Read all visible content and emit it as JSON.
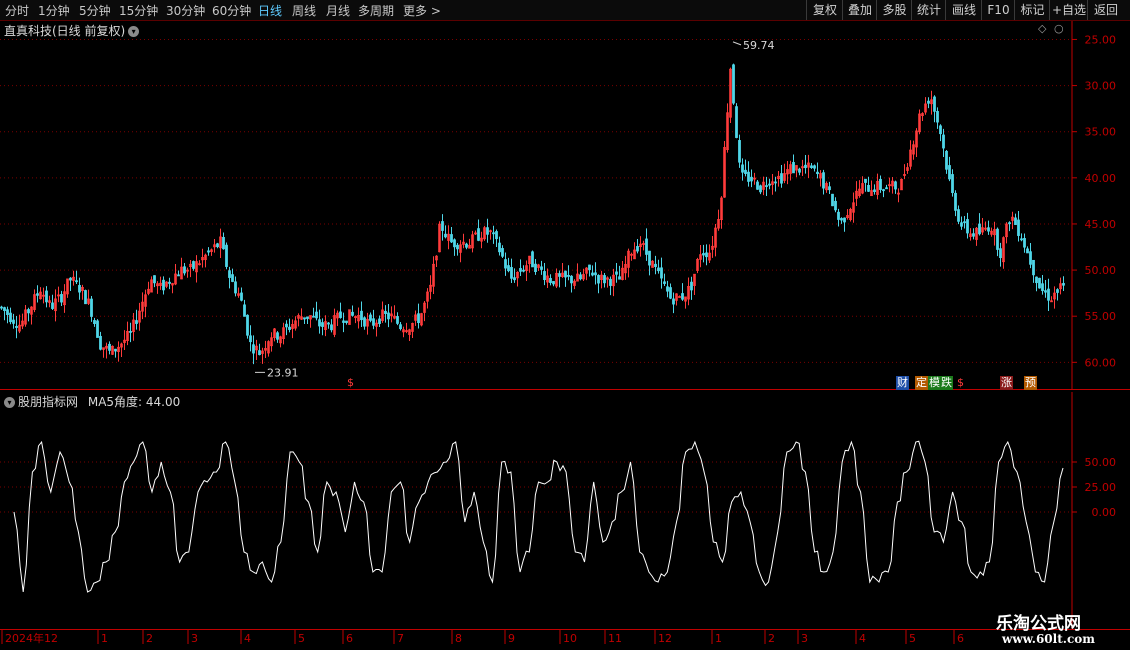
{
  "toolbar": {
    "periods": [
      "分时",
      "1分钟",
      "5分钟",
      "15分钟",
      "30分钟",
      "60分钟",
      "日线",
      "周线",
      "月线",
      "多周期",
      "更多 >"
    ],
    "active_period": "日线",
    "buttons": [
      "复权",
      "叠加",
      "多股",
      "统计",
      "画线",
      "F10",
      "标记",
      "+自选",
      "返回"
    ]
  },
  "main": {
    "title": "直真科技(日线 前复权)",
    "y_ticks": [
      "60.00",
      "55.00",
      "50.00",
      "45.00",
      "40.00",
      "35.00",
      "30.00",
      "25.00"
    ],
    "high_label": "59.74",
    "low_label": "23.91",
    "badges": [
      "$",
      "财",
      "定",
      "模",
      "跌",
      "$",
      "涨",
      "预"
    ]
  },
  "sub": {
    "title": "股朋指标网",
    "indicator_label": "MA5角度: 44.00",
    "y_ticks": [
      "50.00",
      "25.00",
      "0.00"
    ]
  },
  "x_axis": {
    "labels": [
      "2024年12",
      "1",
      "2",
      "3",
      "4",
      "5",
      "6",
      "7",
      "8",
      "9",
      "10",
      "11",
      "12",
      "1",
      "2",
      "3",
      "4",
      "5",
      "6"
    ]
  },
  "watermark": {
    "name": "乐淘公式网",
    "url": "www.60lt.com"
  },
  "colors": {
    "up": "#ff3b3b",
    "down": "#4fd6e8",
    "indicator": "#ffffff",
    "axis": "#c00000",
    "active": "#5ecbff"
  },
  "chart_data": [
    {
      "type": "candlestick",
      "title": "直真科技(日线 前复权)",
      "ylim": [
        22,
        62
      ],
      "y_ticks": [
        25,
        30,
        35,
        40,
        45,
        50,
        55,
        60
      ],
      "max_label": 59.74,
      "min_label": 23.91,
      "close_path": [
        [
          0,
          31
        ],
        [
          10,
          30
        ],
        [
          20,
          29
        ],
        [
          30,
          31
        ],
        [
          40,
          33
        ],
        [
          50,
          31
        ],
        [
          60,
          32
        ],
        [
          70,
          34
        ],
        [
          80,
          33
        ],
        [
          90,
          31
        ],
        [
          100,
          27
        ],
        [
          110,
          26
        ],
        [
          120,
          27
        ],
        [
          130,
          28
        ],
        [
          140,
          31
        ],
        [
          150,
          34
        ],
        [
          160,
          33
        ],
        [
          170,
          34
        ],
        [
          180,
          35
        ],
        [
          190,
          35
        ],
        [
          200,
          36
        ],
        [
          210,
          37
        ],
        [
          220,
          38
        ],
        [
          230,
          34
        ],
        [
          240,
          32
        ],
        [
          250,
          27
        ],
        [
          260,
          26
        ],
        [
          270,
          28
        ],
        [
          280,
          28
        ],
        [
          290,
          29
        ],
        [
          300,
          30
        ],
        [
          310,
          30
        ],
        [
          320,
          29
        ],
        [
          330,
          29
        ],
        [
          340,
          30
        ],
        [
          350,
          30
        ],
        [
          360,
          30
        ],
        [
          370,
          29
        ],
        [
          380,
          30
        ],
        [
          390,
          30
        ],
        [
          400,
          29
        ],
        [
          410,
          29
        ],
        [
          420,
          30
        ],
        [
          430,
          33
        ],
        [
          440,
          40
        ],
        [
          450,
          38
        ],
        [
          460,
          38
        ],
        [
          470,
          38
        ],
        [
          480,
          39
        ],
        [
          490,
          39
        ],
        [
          500,
          37
        ],
        [
          510,
          34
        ],
        [
          520,
          35
        ],
        [
          530,
          36
        ],
        [
          540,
          35
        ],
        [
          550,
          34
        ],
        [
          560,
          34
        ],
        [
          570,
          34
        ],
        [
          580,
          34
        ],
        [
          590,
          35
        ],
        [
          600,
          34
        ],
        [
          610,
          34
        ],
        [
          620,
          34
        ],
        [
          630,
          37
        ],
        [
          640,
          38
        ],
        [
          650,
          36
        ],
        [
          660,
          34
        ],
        [
          670,
          32
        ],
        [
          680,
          32
        ],
        [
          690,
          33
        ],
        [
          700,
          37
        ],
        [
          710,
          37
        ],
        [
          720,
          42
        ],
        [
          730,
          57
        ],
        [
          740,
          45
        ],
        [
          750,
          45
        ],
        [
          760,
          44
        ],
        [
          770,
          45
        ],
        [
          780,
          45
        ],
        [
          790,
          46
        ],
        [
          800,
          46
        ],
        [
          810,
          46
        ],
        [
          820,
          45
        ],
        [
          830,
          43
        ],
        [
          840,
          40
        ],
        [
          850,
          42
        ],
        [
          860,
          44
        ],
        [
          870,
          44
        ],
        [
          880,
          44
        ],
        [
          890,
          44
        ],
        [
          900,
          44
        ],
        [
          910,
          48
        ],
        [
          920,
          52
        ],
        [
          930,
          54
        ],
        [
          940,
          50
        ],
        [
          950,
          44
        ],
        [
          960,
          40
        ],
        [
          970,
          39
        ],
        [
          980,
          39
        ],
        [
          990,
          40
        ],
        [
          1000,
          37
        ],
        [
          1010,
          41
        ],
        [
          1020,
          39
        ],
        [
          1030,
          36
        ],
        [
          1040,
          33
        ],
        [
          1050,
          32
        ],
        [
          1060,
          33
        ]
      ]
    },
    {
      "type": "line",
      "title": "MA5角度",
      "series": [
        {
          "name": "MA5角度",
          "values": [
            0,
            -80,
            40,
            70,
            20,
            60,
            30,
            -20,
            -80,
            -70,
            -50,
            -20,
            30,
            50,
            70,
            20,
            50,
            20,
            -50,
            -40,
            20,
            30,
            40,
            70,
            30,
            -40,
            -60,
            -50,
            -70,
            -30,
            60,
            50,
            10,
            -40,
            30,
            20,
            -20,
            30,
            10,
            -60,
            -60,
            20,
            30,
            -30,
            10,
            30,
            40,
            50,
            70,
            -10,
            20,
            -30,
            -70,
            50,
            40,
            -60,
            -40,
            30,
            30,
            50,
            40,
            -40,
            -50,
            30,
            -30,
            -10,
            20,
            50,
            -40,
            -60,
            -70,
            -60,
            -10,
            60,
            70,
            40,
            -30,
            -50,
            10,
            20,
            -10,
            -60,
            -70,
            -20,
            60,
            70,
            40,
            -40,
            -60,
            -40,
            50,
            70,
            20,
            -70,
            -70,
            -60,
            10,
            40,
            70,
            50,
            -20,
            -30,
            20,
            -10,
            -60,
            -60,
            -50,
            50,
            70,
            40,
            -10,
            -60,
            -70,
            -10,
            44
          ]
        }
      ],
      "ylim": [
        -100,
        100
      ],
      "y_ticks": [
        50,
        25,
        0
      ],
      "current": 44.0
    }
  ]
}
